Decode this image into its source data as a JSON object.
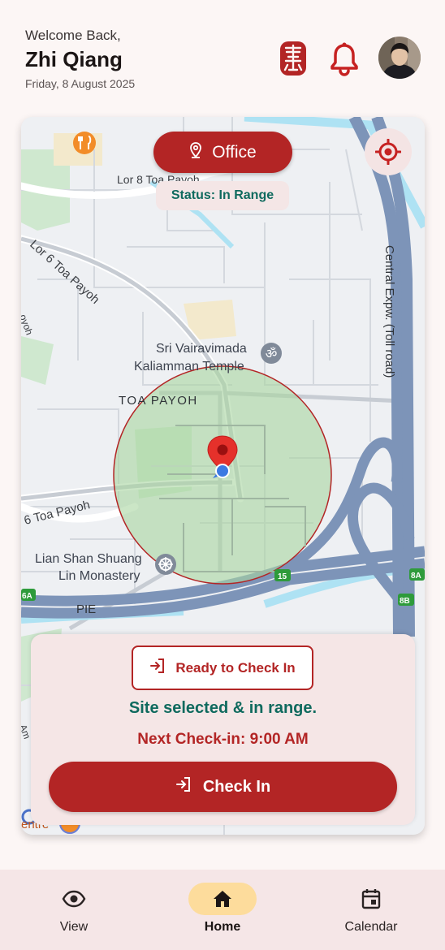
{
  "header": {
    "welcome": "Welcome Back,",
    "user_name": "Zhi Qiang",
    "date": "Friday, 8 August 2025"
  },
  "map": {
    "site_name": "Office",
    "status": "Status: In Range",
    "labels": {
      "street_lor8": "Lor 8 Toa Payoh",
      "street_lor6": "Lor 6 Toa Payoh",
      "street_lor6_partial": "oyoh",
      "street_6": "6 Toa Payoh",
      "temple_line1": "Sri Vairavimada",
      "temple_line2": "Kaliamman Temple",
      "district": "TOA PAYOH",
      "monastery_line1": "Lian Shan Shuang",
      "monastery_line2": "Lin Monastery",
      "expressway": "Central Expw. (Toll road)",
      "pie": "PIE",
      "exit_15": "15",
      "exit_6a": "6A",
      "exit_8a": "8A",
      "exit_8b": "8B",
      "partial_centre": "entre",
      "partial_am": "Am"
    },
    "colors": {
      "range_fill": "#a8d5a0",
      "range_border": "#b32525",
      "marker": "#e5312b"
    }
  },
  "checkin": {
    "ready_label": "Ready to Check In",
    "site_status": "Site selected & in range.",
    "next_checkin": "Next Check-in: 9:00 AM",
    "button_label": "Check In"
  },
  "nav": {
    "items": [
      {
        "label": "View",
        "icon": "eye-icon"
      },
      {
        "label": "Home",
        "icon": "home-icon"
      },
      {
        "label": "Calendar",
        "icon": "calendar-icon"
      }
    ],
    "active": "Home"
  },
  "theme": {
    "primary": "#b32525",
    "accent_teal": "#0f6a5e",
    "nav_active": "#fddc9c"
  }
}
